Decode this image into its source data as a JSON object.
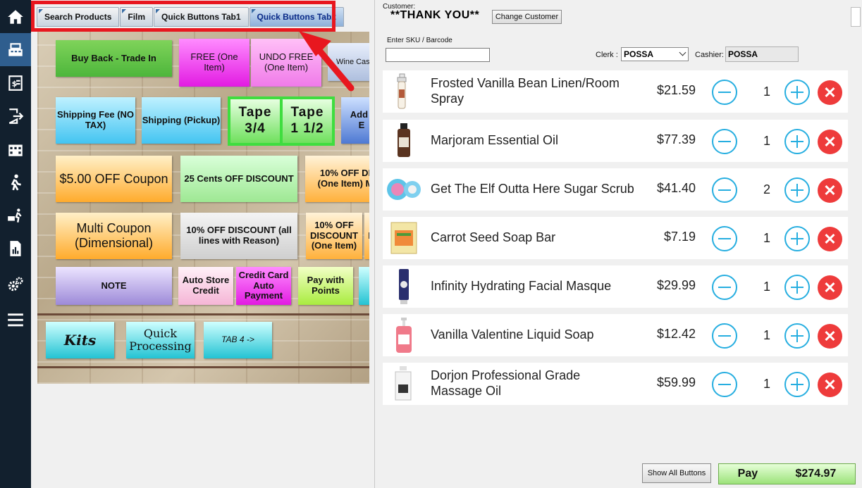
{
  "sidebar": {
    "items": [
      {
        "icon": "home-icon"
      },
      {
        "icon": "register-icon"
      },
      {
        "icon": "price-tag-icon"
      },
      {
        "icon": "exit-icon"
      },
      {
        "icon": "building-icon"
      },
      {
        "icon": "walking-person-icon"
      },
      {
        "icon": "cart-delivery-icon"
      },
      {
        "icon": "report-icon"
      },
      {
        "icon": "gears-icon"
      },
      {
        "icon": "menu-icon"
      }
    ]
  },
  "tabs": [
    {
      "label": "Search Products",
      "active": false
    },
    {
      "label": "Film",
      "active": false
    },
    {
      "label": "Quick Buttons Tab1",
      "active": false
    },
    {
      "label": "Quick Buttons Tab2",
      "active": true
    }
  ],
  "quick_buttons": {
    "buy_back": "Buy Back - Trade In",
    "free_one": "FREE (One Item)",
    "undo_free": "UNDO FREE (One Item)",
    "wine_case": "Wine Cas",
    "shipping_fee": "Shipping Fee (NO TAX)",
    "shipping_pickup": "Shipping (Pickup)",
    "tape_3_4": {
      "line1": "Tape",
      "line2": "3/4"
    },
    "tape_1_1_2": {
      "line1": "Tape",
      "line2": "1 1/2"
    },
    "add": "Add I E",
    "coupon_5": "$5.00 OFF Coupon",
    "cents_25": "25 Cents OFF DISCOUNT",
    "pct10_one_item_partial": "10% OFF DI (One Item) M",
    "multi_coupon": "Multi Coupon (Dimensional)",
    "pct10_all_lines": "10% OFF DISCOUNT (all lines with Reason)",
    "pct10_one_item": "10% OFF DISCOUNT (One Item)",
    "pct10_partial_d": "D",
    "note": "NOTE",
    "auto_store_credit": "Auto Store Credit",
    "credit_card_auto": "Credit Card Auto Payment",
    "pay_with_points": "Pay with Points",
    "kits": "Kits",
    "quick_processing": "Quick Processing",
    "tab4": "TAB 4 ->"
  },
  "header": {
    "customer_label": "Customer:",
    "customer_name": "**THANK YOU**",
    "change_customer": "Change Customer",
    "sku_label": "Enter SKU / Barcode",
    "sku_value": "",
    "clerk_label": "Clerk :",
    "clerk_value": "POSSA",
    "cashier_label": "Cashier:",
    "cashier_value": "POSSA"
  },
  "cart": {
    "items": [
      {
        "name": "Frosted Vanilla Bean Linen/Room Spray",
        "price": "$21.59",
        "qty": "1",
        "thumb": "spray-bottle-icon"
      },
      {
        "name": "Marjoram Essential Oil",
        "price": "$77.39",
        "qty": "1",
        "thumb": "oil-bottle-icon"
      },
      {
        "name": "Get The Elf Outta Here Sugar Scrub",
        "price": "$41.40",
        "qty": "2",
        "thumb": "scrub-jar-icon"
      },
      {
        "name": "Carrot Seed Soap Bar",
        "price": "$7.19",
        "qty": "1",
        "thumb": "soap-bar-icon"
      },
      {
        "name": "Infinity Hydrating Facial Masque",
        "price": "$29.99",
        "qty": "1",
        "thumb": "tube-icon"
      },
      {
        "name": "Vanilla Valentine Liquid Soap",
        "price": "$12.42",
        "qty": "1",
        "thumb": "pump-bottle-icon"
      },
      {
        "name": "Dorjon Professional Grade Massage Oil",
        "price": "$59.99",
        "qty": "1",
        "thumb": "jug-icon"
      }
    ]
  },
  "footer": {
    "show_all": "Show All Buttons",
    "pay_label": "Pay",
    "pay_total": "$274.97"
  },
  "colors": {
    "sidebar_bg": "#12202e",
    "sidebar_active": "#2f5e8e",
    "highlight_red": "#e8171f",
    "qty_blue": "#26aee0",
    "delete_red": "#ee3b3b",
    "pay_green": "#9ce27a"
  }
}
